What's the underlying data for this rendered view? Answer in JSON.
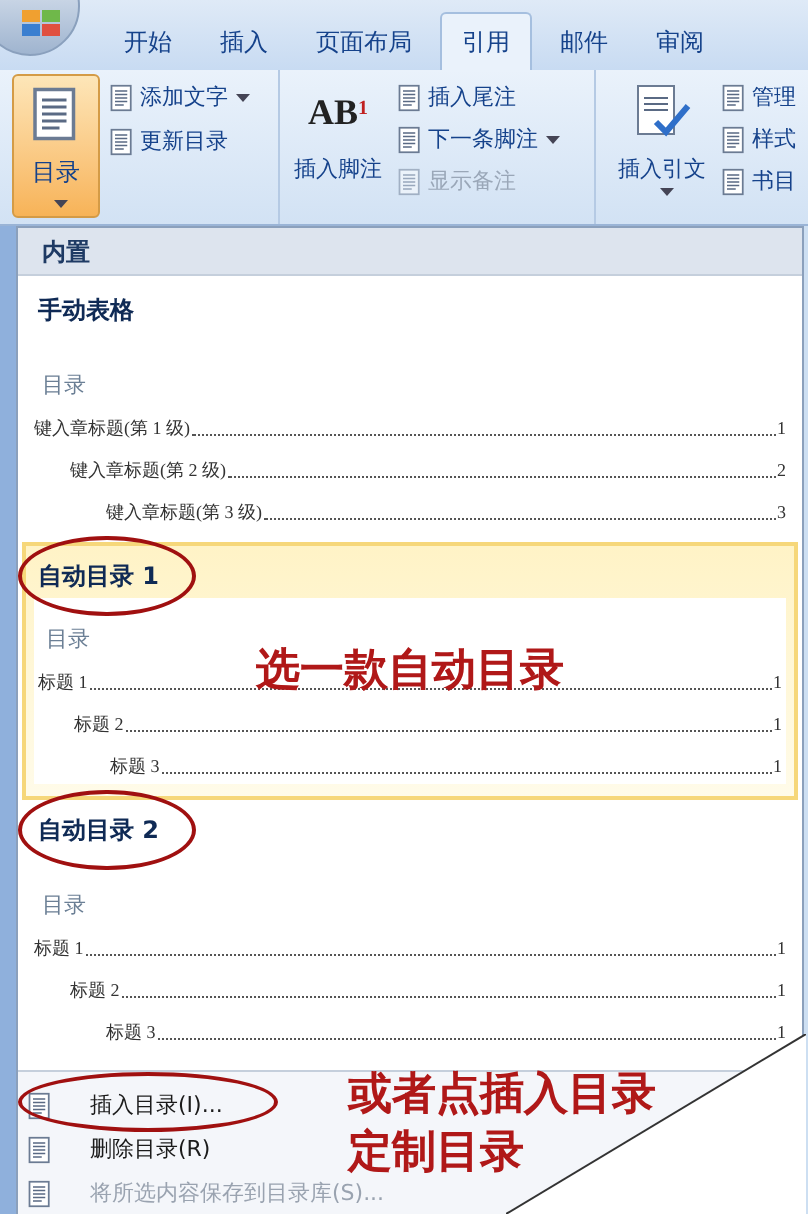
{
  "tabs": [
    {
      "label": "开始",
      "selected": false
    },
    {
      "label": "插入",
      "selected": false
    },
    {
      "label": "页面布局",
      "selected": false
    },
    {
      "label": "引用",
      "selected": true
    },
    {
      "label": "邮件",
      "selected": false
    },
    {
      "label": "审阅",
      "selected": false
    }
  ],
  "ribbon": {
    "toc_button": {
      "label": "目录",
      "pressed": true
    },
    "toc_items": [
      {
        "label": "添加文字",
        "dropdown": true
      },
      {
        "label": "更新目录",
        "dropdown": false
      }
    ],
    "footnote_button": {
      "label": "插入脚注",
      "icon_text": "AB$^{1}$"
    },
    "footnote_items": [
      {
        "label": "插入尾注",
        "dropdown": false,
        "disabled": false
      },
      {
        "label": "下一条脚注",
        "dropdown": true,
        "disabled": false
      },
      {
        "label": "显示备注",
        "dropdown": false,
        "disabled": true
      }
    ],
    "citation_button": {
      "label": "插入引文"
    },
    "citation_items": [
      {
        "label": "管理"
      },
      {
        "label": "样式"
      },
      {
        "label": "书目"
      }
    ]
  },
  "gallery": {
    "header": "内置",
    "entries": [
      {
        "title": "手动表格",
        "highlighted": false,
        "circled": false,
        "heading": "目录",
        "lines": [
          {
            "text": "键入章标题(第 1 级)",
            "page": "1",
            "children": [
              {
                "text": "键入章标题(第 2 级)",
                "page": "2",
                "children": [
                  {
                    "text": "键入章标题(第 3 级)",
                    "page": "3"
                  }
                ]
              }
            ]
          }
        ]
      },
      {
        "title": "自动目录 1",
        "highlighted": true,
        "circled": true,
        "heading": "目录",
        "lines": [
          {
            "text": "标题 1",
            "page": "1",
            "children": [
              {
                "text": "标题 2",
                "page": "1",
                "children": [
                  {
                    "text": "标题 3",
                    "page": "1"
                  }
                ]
              }
            ]
          }
        ]
      },
      {
        "title": "自动目录 2",
        "highlighted": false,
        "circled": true,
        "heading": "目录",
        "lines": [
          {
            "text": "标题 1",
            "page": "1",
            "children": [
              {
                "text": "标题 2",
                "page": "1",
                "children": [
                  {
                    "text": "标题 3",
                    "page": "1"
                  }
                ]
              }
            ]
          }
        ]
      }
    ],
    "menu_items": [
      {
        "label": "插入目录(I)...",
        "disabled": false,
        "circled": true
      },
      {
        "label": "删除目录(R)",
        "disabled": false,
        "circled": false
      },
      {
        "label": "将所选内容保存到目录库(S)...",
        "disabled": true,
        "circled": false
      }
    ]
  },
  "annotations": [
    {
      "lines": [
        "选一款自动目录"
      ]
    },
    {
      "lines": [
        "或者点插入目录",
        "定制目录"
      ]
    }
  ]
}
